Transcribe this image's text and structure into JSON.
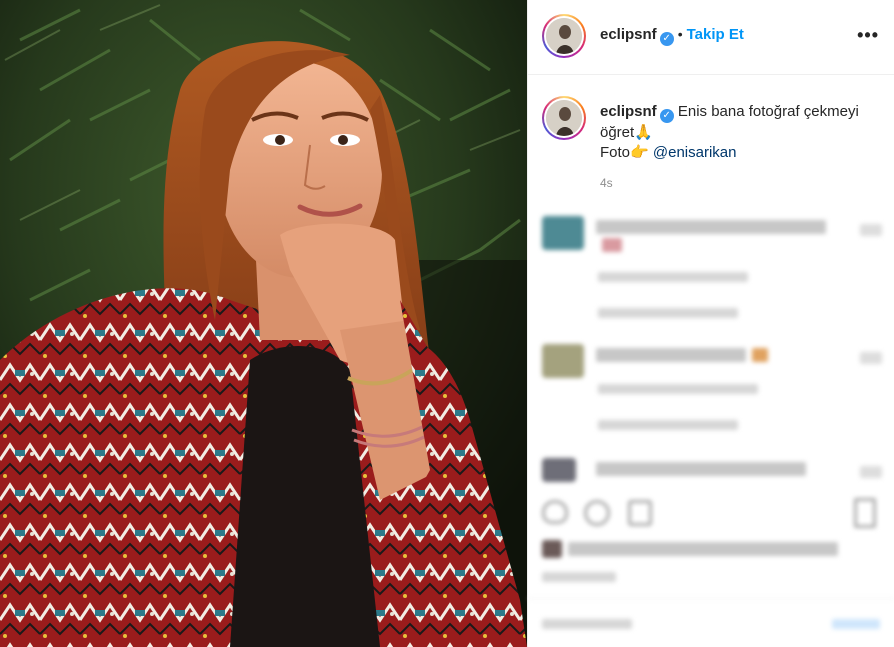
{
  "post": {
    "username": "eclipsnf",
    "verified_mark": "✓",
    "separator": "•",
    "follow_label": "Takip Et",
    "more_label": "•••"
  },
  "caption": {
    "username": "eclipsnf",
    "line1": "Enis bana fotoğraf çekmeyi",
    "line2": "öğret",
    "line2_emoji": "🙏",
    "line3_prefix": "Foto",
    "line3_emoji": "👉",
    "mention": "@enisarikan",
    "timestamp": "4s"
  },
  "icons": {
    "verified": "verified-badge-icon",
    "more": "more-options-icon",
    "heart": "heart-icon",
    "comment": "comment-icon",
    "share": "share-icon",
    "save": "bookmark-icon"
  },
  "colors": {
    "follow": "#0095f6",
    "verified": "#3897f0",
    "mention": "#00376b",
    "meta": "#8e8e8e",
    "border": "#efefef"
  }
}
